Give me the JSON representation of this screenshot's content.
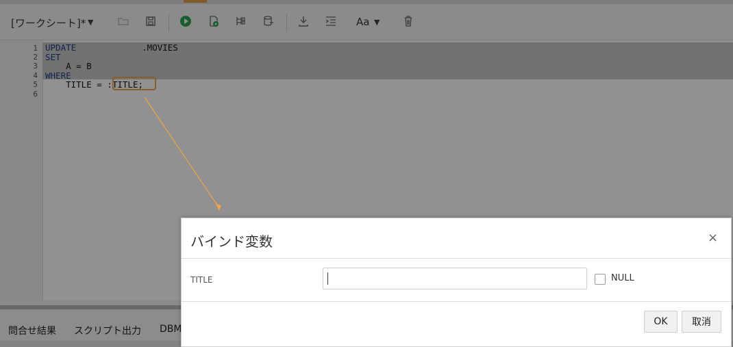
{
  "toolbar": {
    "worksheet_title": "[ワークシート]*",
    "font_label": "Aa"
  },
  "editor": {
    "line_numbers": [
      "1",
      "2",
      "3",
      "4",
      "5",
      "6"
    ],
    "lines": {
      "l1_kw": "UPDATE",
      "l1_tail": ".MOVIES",
      "l2_kw": "SET",
      "l3_text": "A = B",
      "l4_kw": "WHERE",
      "l5_text": "TITLE = ",
      "l5_bind": ":TITLE;"
    }
  },
  "bottom_tabs": {
    "query_results": "問合せ結果",
    "script_output": "スクリプト出力",
    "dbms": "DBM"
  },
  "dialog": {
    "title": "バインド変数",
    "close": "×",
    "field_label": "TITLE",
    "field_value": "",
    "null_label": "NULL",
    "ok_label": "OK",
    "cancel_label": "取消"
  },
  "colors": {
    "accent_orange": "#f0a54b",
    "keyword_blue": "#1f3c88",
    "run_green": "#2ea44f"
  }
}
